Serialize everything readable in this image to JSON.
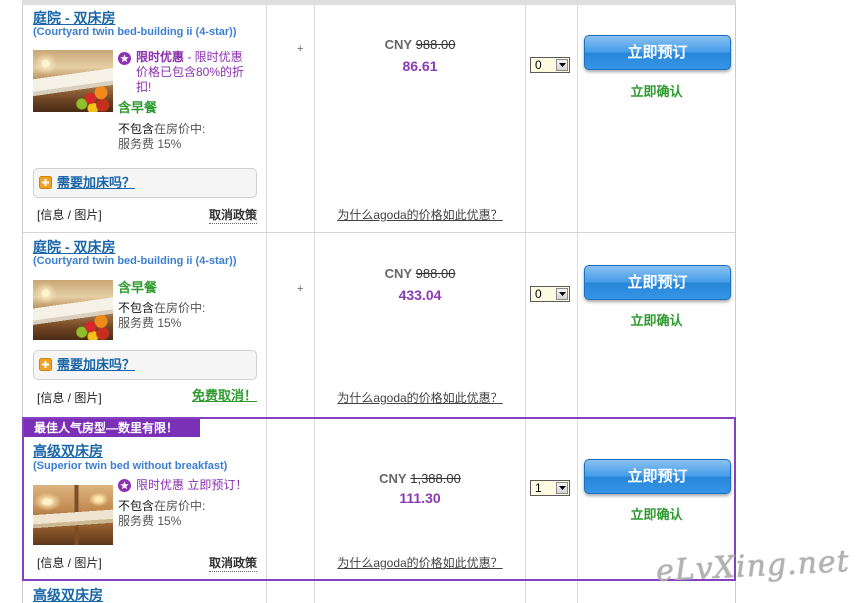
{
  "colors": {
    "link_blue": "#1a66a8",
    "subtitle_blue": "#3a7fd3",
    "promo_purple": "#8c2fb0",
    "price_purple": "#8a3bb4",
    "confirm_green": "#2f9a2f",
    "button_blue": "#2a8ee6",
    "featured_purple": "#8540c4",
    "extra_bed_orange": "#f2a224"
  },
  "icons": {
    "promo": "star-icon",
    "extra_bed": "plus-square-icon",
    "quantity_dropdown": "chevron-down-icon"
  },
  "rooms": [
    {
      "title": "庭院 - 双床房",
      "subtitle": "(Courtyard twin bed-building ii (4-star))",
      "promo": {
        "label": "限时优惠",
        "text": " - 限时优惠价格已包含80%的折扣!"
      },
      "breakfast": "含早餐",
      "excluded": {
        "label": "不包含",
        "text": "在房价中:"
      },
      "service_fee": "服务费 15%",
      "extra_bed": "需要加床吗？",
      "info_link": "[信息 / 图片]",
      "cancellation": "取消政策",
      "occupancy_plus": "+",
      "currency": "CNY",
      "original_price": "988.00",
      "price": "86.61",
      "why_link": "为什么agoda的价格如此优惠？",
      "quantity": "0",
      "book_button": "立即预订",
      "confirmation": "立即确认"
    },
    {
      "title": "庭院 - 双床房",
      "subtitle": "(Courtyard twin bed-building ii (4-star))",
      "breakfast": "含早餐",
      "excluded": {
        "label": "不包含",
        "text": "在房价中:"
      },
      "service_fee": "服务费 15%",
      "extra_bed": "需要加床吗？",
      "info_link": "[信息 / 图片]",
      "cancellation": "免费取消！",
      "occupancy_plus": "+",
      "currency": "CNY",
      "original_price": "988.00",
      "price": "433.04",
      "why_link": "为什么agoda的价格如此优惠？",
      "quantity": "0",
      "book_button": "立即预订",
      "confirmation": "立即确认"
    },
    {
      "featured_banner": "最佳人气房型—数里有限！",
      "title": "高级双床房",
      "subtitle": "(Superior twin bed without breakfast)",
      "promo": {
        "label": "限时优惠",
        "text": " 立即预订！"
      },
      "excluded": {
        "label": "不包含",
        "text": "在房价中:"
      },
      "service_fee": "服务费 15%",
      "info_link": "[信息 / 图片]",
      "cancellation": "取消政策",
      "currency": "CNY",
      "original_price": "1,388.00",
      "price": "111.30",
      "why_link": "为什么agoda的价格如此优惠？",
      "quantity": "1",
      "book_button": "立即预订",
      "confirmation": "立即确认"
    },
    {
      "title": "高级双床房"
    }
  ],
  "watermark": "eLvXing.net"
}
